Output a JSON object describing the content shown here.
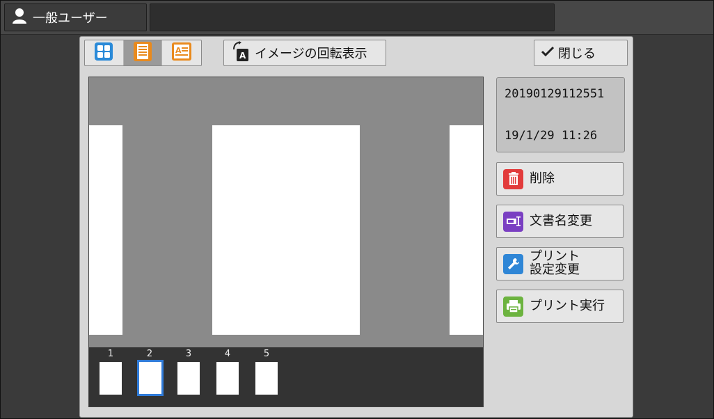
{
  "header": {
    "user_label": "一般ユーザー",
    "status_text": ""
  },
  "toolbar": {
    "view_modes": [
      "grid-view",
      "single-page-view",
      "text-page-view"
    ],
    "active_view_index": 1,
    "rotate_label": "イメージの回転表示",
    "close_label": "閉じる"
  },
  "document": {
    "name": "20190129112551",
    "timestamp": "19/1/29 11:26"
  },
  "thumbnails": [
    {
      "number": "1"
    },
    {
      "number": "2"
    },
    {
      "number": "3"
    },
    {
      "number": "4"
    },
    {
      "number": "5"
    }
  ],
  "selected_thumbnail": "2",
  "actions": {
    "delete_label": "削除",
    "rename_label": "文書名変更",
    "print_settings_line1": "プリント",
    "print_settings_line2": "設定変更",
    "print_label": "プリント実行"
  },
  "colors": {
    "delete_icon": "#e23b3b",
    "rename_icon": "#7a3fc2",
    "settings_icon": "#2f86d6",
    "print_icon": "#6cb33f",
    "view_icon_blue": "#2a8ad8",
    "view_icon_orange": "#e98a1d",
    "selection": "#2f7bd9"
  }
}
